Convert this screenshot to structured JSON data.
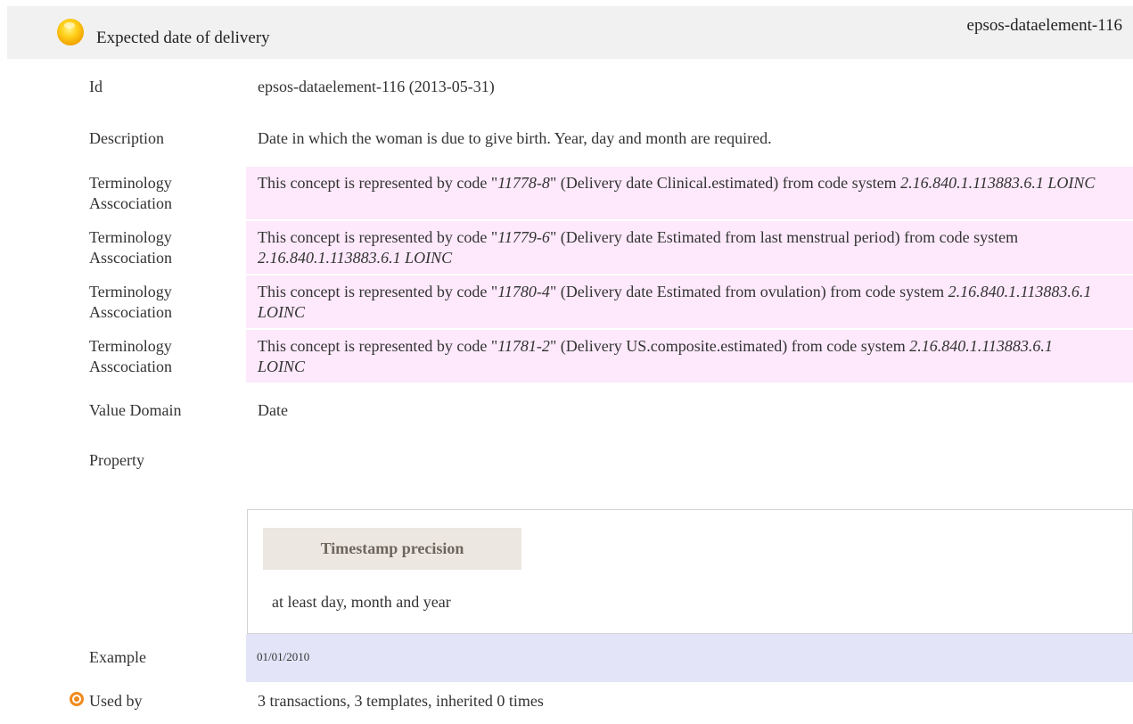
{
  "header": {
    "title": "Expected date of delivery",
    "element_id": "epsos-dataelement-116"
  },
  "fields": {
    "id": {
      "label": "Id",
      "value": "epsos-dataelement-116 (2013-05-31)"
    },
    "description": {
      "label": "Description",
      "value": "Date in which the woman is due to give birth. Year, day and month are required."
    },
    "value_domain": {
      "label": "Value Domain",
      "value": "Date"
    },
    "property": {
      "label": "Property",
      "header": "Timestamp precision",
      "value": "at least day, month and year"
    },
    "example": {
      "label": "Example",
      "value": "01/01/2010"
    },
    "used_by": {
      "label": "Used by",
      "value": "3 transactions, 3 templates, inherited 0 times"
    }
  },
  "terminology": {
    "label_line1": "Terminology",
    "label_line2": "Asscociation",
    "prefix": "This concept is represented by code \"",
    "code_suffix": "\"",
    "from_code_system": "from code system",
    "code_system": "2.16.840.1.113883.6.1 LOINC",
    "items": [
      {
        "code": "11778-8",
        "display": "(Delivery date Clinical.estimated)"
      },
      {
        "code": "11779-6",
        "display": "(Delivery date Estimated from last menstrual period)"
      },
      {
        "code": "11780-4",
        "display": "(Delivery date Estimated from ovulation)"
      },
      {
        "code": "11781-2",
        "display": "(Delivery US.composite.estimated)"
      }
    ]
  }
}
